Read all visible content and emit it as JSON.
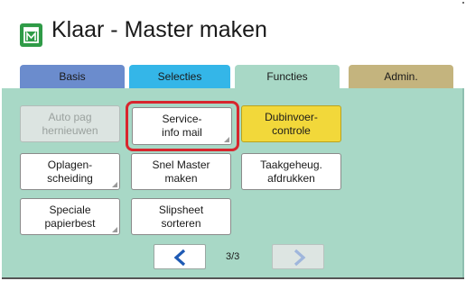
{
  "header": {
    "title": "Klaar - Master maken",
    "icon": "master-icon",
    "icon_color": "#2f9b47"
  },
  "tabs": [
    {
      "label": "Basis",
      "color": "#6b8ccd"
    },
    {
      "label": "Selecties",
      "color": "#34b6e8"
    },
    {
      "label": "Functies",
      "color": "#a8d8c6",
      "active": true
    },
    {
      "label": "Admin.",
      "color": "#c4b47e"
    }
  ],
  "buttons": {
    "auto_page": {
      "label": "Auto pag\nhernieuwen",
      "enabled": false
    },
    "service_info": {
      "label": "Service-\ninfo mail",
      "highlighted": true
    },
    "dubinvoer": {
      "label": "Dubinvoer-\ncontrole",
      "active": true
    },
    "oplagen": {
      "label": "Oplagen-\nscheiding"
    },
    "snel_master": {
      "label": "Snel Master\nmaken"
    },
    "taakgeheug": {
      "label": "Taakgeheug.\nafdrukken"
    },
    "speciale": {
      "label": "Speciale\npapierbest"
    },
    "slipsheet": {
      "label": "Slipsheet\nsorteren"
    }
  },
  "pager": {
    "page_text": "3/3",
    "prev_icon": "chevron-left-icon",
    "next_icon": "chevron-right-icon"
  },
  "colors": {
    "panel": "#a8d8c6",
    "highlight": "#d7262e",
    "active_button": "#f2d83a",
    "arrow": "#1e5ab4"
  }
}
